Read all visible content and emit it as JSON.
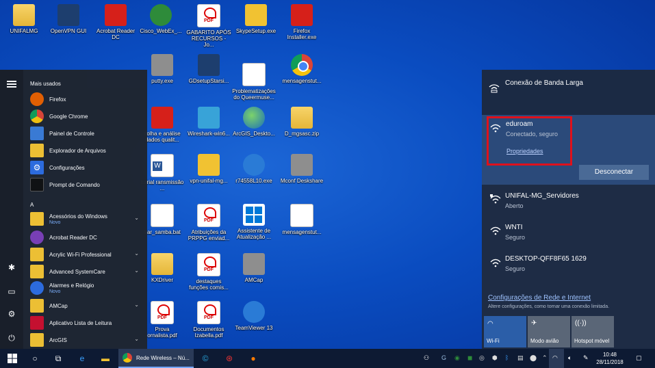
{
  "desktop": {
    "icons": [
      {
        "label": "UNIFALMG"
      },
      {
        "label": "OpenVPN GUI"
      },
      {
        "label": "Acrobat Reader DC"
      },
      {
        "label": "Cisco_WebEx_..."
      },
      {
        "label": "GABARITO APÓS RECURSOS - Jo..."
      },
      {
        "label": "SkypeSetup.exe"
      },
      {
        "label": "Firefox Installer.exe"
      },
      {
        "label": "putty.exe"
      },
      {
        "label": "GDsetupStarsi..."
      },
      {
        "label": "Problematizações do Queermuse..."
      },
      {
        "label": "mensagenstut..."
      },
      {
        "label": "colha e análise dados qualit..."
      },
      {
        "label": "Wireshark-win6..."
      },
      {
        "label": "ArcGIS_Deskto..."
      },
      {
        "label": "D_mgsasc.zip"
      },
      {
        "label": "tutrial ransmissão ..."
      },
      {
        "label": "vpn-unifal-mg..."
      },
      {
        "label": "r74558L10.exe"
      },
      {
        "label": "Mconf Deskshare"
      },
      {
        "label": "trar_samba.bat"
      },
      {
        "label": "Atribuições da PRPPG enviad..."
      },
      {
        "label": "Assistente de Atualização ..."
      },
      {
        "label": "mensagenstut..."
      },
      {
        "label": "KXDriver"
      },
      {
        "label": "destaques funções comis..."
      },
      {
        "label": "AMCap"
      },
      {
        "label": "Prova ornalista.pdf"
      },
      {
        "label": "Documentos Izabella.pdf"
      },
      {
        "label": "TeamViewer 13"
      }
    ]
  },
  "start_menu": {
    "most_used_header": "Mais usados",
    "most_used": [
      {
        "label": "Firefox",
        "color": "#e66000"
      },
      {
        "label": "Google Chrome",
        "color": "#4285f4"
      },
      {
        "label": "Painel de Controle",
        "color": "#3a7bd5"
      },
      {
        "label": "Explorador de Arquivos",
        "color": "#f1c232"
      },
      {
        "label": "Configurações",
        "color": "#2d6cdf"
      },
      {
        "label": "Prompt de Comando",
        "color": "#111111"
      }
    ],
    "section_letter": "A",
    "apps": [
      {
        "label": "Acessórios do Windows",
        "sub": "Novo",
        "color": "#f1c232",
        "chevron": "⌄"
      },
      {
        "label": "Acrobat Reader DC",
        "sub": "",
        "color": "#7b3fb5",
        "chevron": ""
      },
      {
        "label": "Acrylic Wi-Fi Professional",
        "sub": "",
        "color": "#f1c232",
        "chevron": "⌄"
      },
      {
        "label": "Advanced SystemCare",
        "sub": "",
        "color": "#f1c232",
        "chevron": "⌄"
      },
      {
        "label": "Alarmes e Relógio",
        "sub": "Novo",
        "color": "#2d6cdf",
        "chevron": ""
      },
      {
        "label": "AMCap",
        "sub": "",
        "color": "#f1c232",
        "chevron": "⌄"
      },
      {
        "label": "Aplicativo Lista de Leitura",
        "sub": "",
        "color": "#c8102e",
        "chevron": ""
      },
      {
        "label": "ArcGIS",
        "sub": "",
        "color": "#f1c232",
        "chevron": "⌄"
      }
    ]
  },
  "network": {
    "broadband": {
      "title": "Conexão de Banda Larga"
    },
    "connected": {
      "ssid": "eduroam",
      "status": "Conectado, seguro",
      "properties_link": "Propriedades",
      "disconnect_label": "Desconectar"
    },
    "networks": [
      {
        "ssid": "UNIFAL-MG_Servidores",
        "status": "Aberto"
      },
      {
        "ssid": "WNTI",
        "status": "Seguro"
      },
      {
        "ssid": "DESKTOP-QFF8F65 1629",
        "status": "Seguro"
      }
    ],
    "settings_link": "Configurações de Rede e Internet",
    "settings_desc": "Altere configurações, como tornar uma conexão limitada.",
    "quick_actions": [
      {
        "label": "Wi-Fi",
        "active": true
      },
      {
        "label": "Modo avião",
        "active": false
      },
      {
        "label": "Hotspot móvel",
        "active": false
      }
    ]
  },
  "taskbar": {
    "active_app": "Rede Wireless – Nú...",
    "time": "10:48",
    "date": "28/11/2018"
  },
  "colors": {
    "accent": "#2b4a7a",
    "highlight_box": "#e0111b"
  }
}
